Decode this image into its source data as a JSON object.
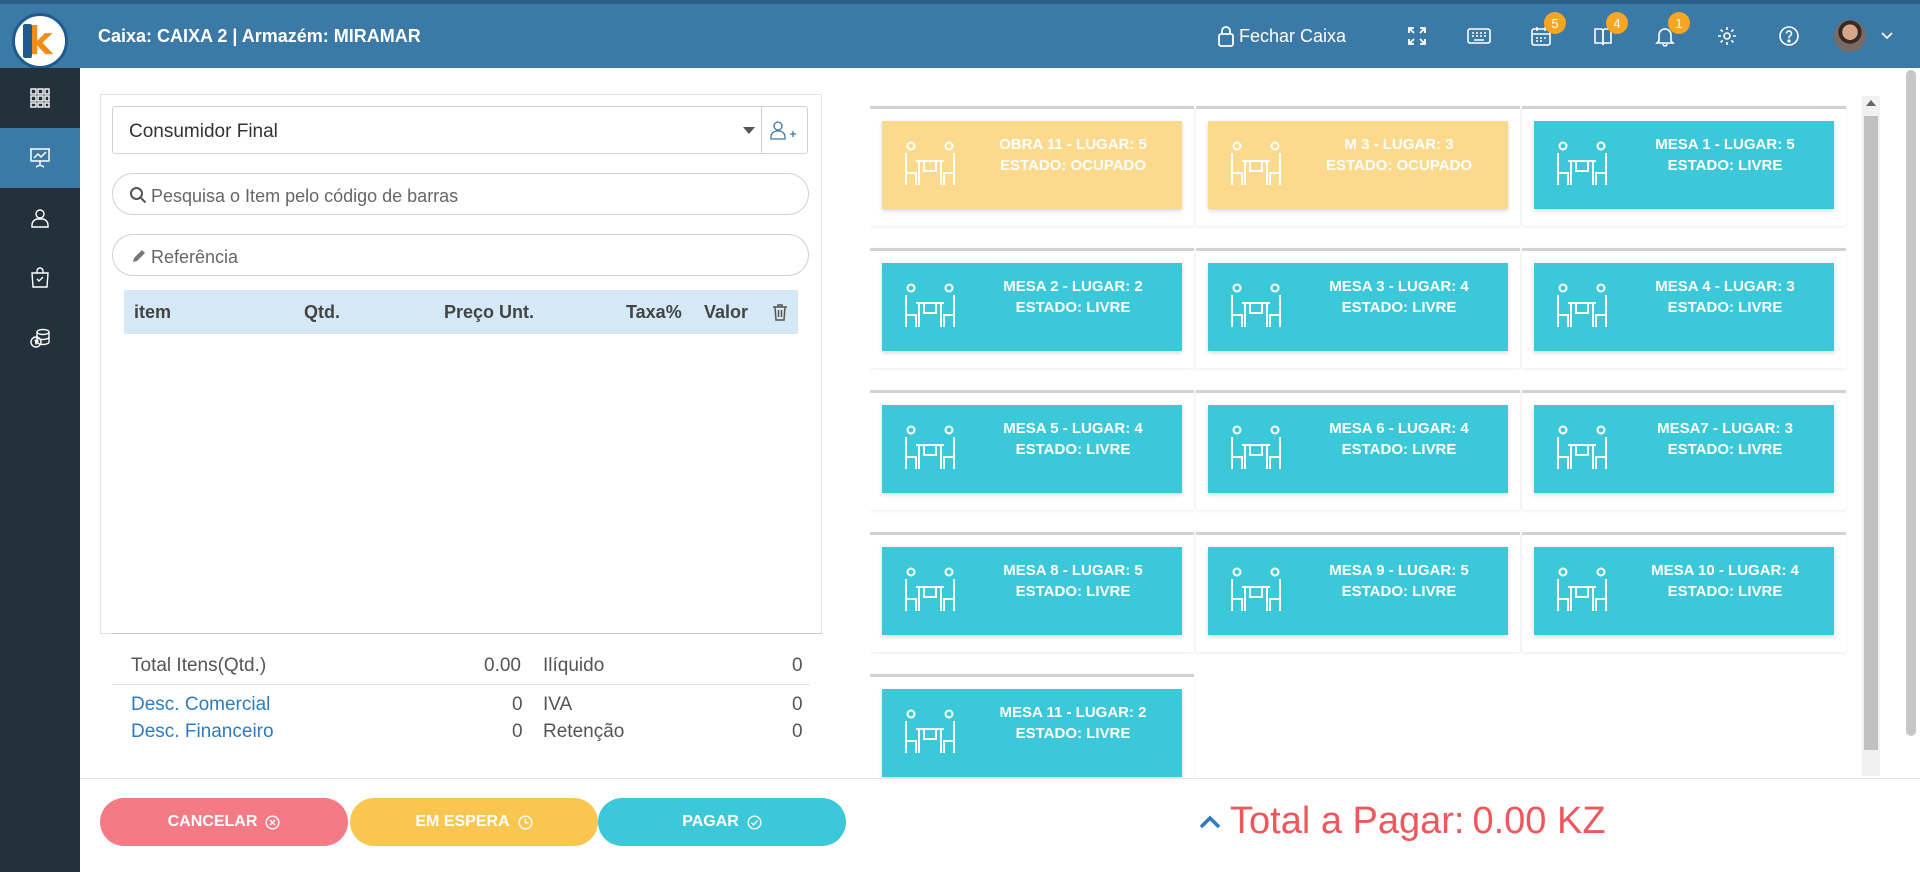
{
  "header": {
    "title": "Caixa: CAIXA 2 | Armazém: MIRAMAR",
    "close_register": "Fechar Caixa",
    "badges": {
      "calendar": "5",
      "orders": "4",
      "notifications": "1"
    }
  },
  "sidebar": {
    "items": [
      {
        "icon": "grid-icon",
        "active": false
      },
      {
        "icon": "presentation-icon",
        "active": true
      },
      {
        "icon": "user-icon",
        "active": false
      },
      {
        "icon": "bag-icon",
        "active": false
      },
      {
        "icon": "coins-icon",
        "active": false
      }
    ]
  },
  "order": {
    "customer": "Consumidor Final",
    "search_placeholder": "Pesquisa o Item pelo código de barras",
    "reference_placeholder": "Referência",
    "columns": {
      "item": "item",
      "qty": "Qtd.",
      "unit_price": "Preço Unt.",
      "tax": "Taxa%",
      "value": "Valor"
    },
    "totals": {
      "items_label": "Total Itens(Qtd.)",
      "items_value": "0.00",
      "net_label": "Ilíquido",
      "net_value": "0",
      "commercial_label": "Desc. Comercial",
      "commercial_value": "0",
      "vat_label": "IVA",
      "vat_value": "0",
      "financial_label": "Desc. Financeiro",
      "financial_value": "0",
      "retention_label": "Retenção",
      "retention_value": "0"
    }
  },
  "tables": [
    {
      "line1": "OBRA 11 - LUGAR: 5",
      "line2": "ESTADO: OCUPADO",
      "status": "ocupado"
    },
    {
      "line1": "M 3 - LUGAR: 3",
      "line2": "ESTADO: OCUPADO",
      "status": "ocupado"
    },
    {
      "line1": "MESA 1 - LUGAR: 5",
      "line2": "ESTADO: LIVRE",
      "status": "livre"
    },
    {
      "line1": "MESA 2 - LUGAR: 2",
      "line2": "ESTADO: LIVRE",
      "status": "livre"
    },
    {
      "line1": "MESA 3 - LUGAR: 4",
      "line2": "ESTADO: LIVRE",
      "status": "livre"
    },
    {
      "line1": "MESA 4 - LUGAR: 3",
      "line2": "ESTADO: LIVRE",
      "status": "livre"
    },
    {
      "line1": "MESA 5 - LUGAR: 4",
      "line2": "ESTADO: LIVRE",
      "status": "livre"
    },
    {
      "line1": "MESA 6 - LUGAR: 4",
      "line2": "ESTADO: LIVRE",
      "status": "livre"
    },
    {
      "line1": "MESA7 - LUGAR: 3",
      "line2": "ESTADO: LIVRE",
      "status": "livre"
    },
    {
      "line1": "MESA 8 - LUGAR: 5",
      "line2": "ESTADO: LIVRE",
      "status": "livre"
    },
    {
      "line1": "MESA 9 - LUGAR: 5",
      "line2": "ESTADO: LIVRE",
      "status": "livre"
    },
    {
      "line1": "MESA 10 - LUGAR: 4",
      "line2": "ESTADO: LIVRE",
      "status": "livre"
    },
    {
      "line1": "MESA 11 - LUGAR: 2",
      "line2": "ESTADO: LIVRE",
      "status": "livre"
    }
  ],
  "actions": {
    "cancel": "CANCELAR",
    "hold": "EM ESPERA",
    "pay": "PAGAR"
  },
  "total": {
    "label": "Total a Pagar:",
    "value": "0.00 KZ"
  },
  "colors": {
    "header": "#3b79a6",
    "sidebar": "#23313a",
    "free": "#3bc8d8",
    "occupied": "#fbd98d",
    "cancel": "#f47a86",
    "hold": "#f9c74f",
    "total": "#f0575c"
  }
}
